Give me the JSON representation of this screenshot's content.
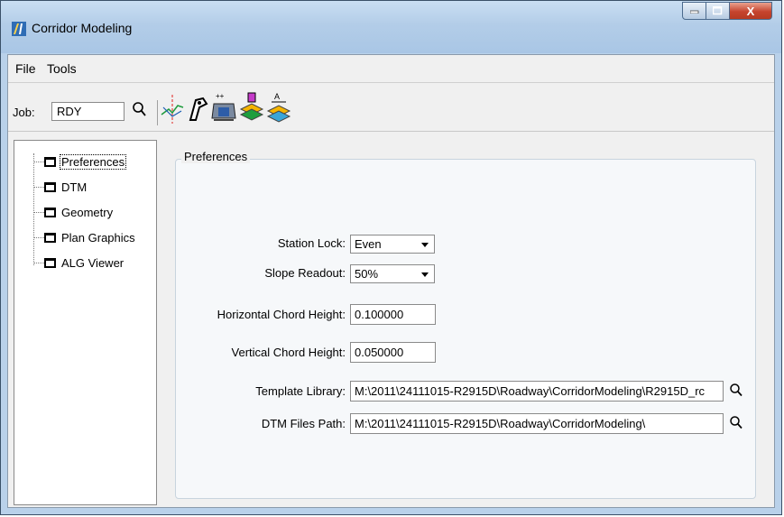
{
  "window": {
    "title": "Corridor Modeling",
    "controls": {
      "minimize": "–",
      "maximize": "□",
      "close": "X"
    }
  },
  "menu": {
    "file_label": "File",
    "tools_label": "Tools"
  },
  "toolbar": {
    "job_label": "Job:",
    "job_value": "RDY",
    "icons": [
      "search-icon",
      "alignment-icon",
      "template-tool-icon",
      "roadway-icon",
      "create-surface-icon",
      "design-stage-icon"
    ]
  },
  "tree": {
    "items": [
      {
        "label": "Preferences",
        "selected": true
      },
      {
        "label": "DTM",
        "selected": false
      },
      {
        "label": "Geometry",
        "selected": false
      },
      {
        "label": "Plan Graphics",
        "selected": false
      },
      {
        "label": "ALG Viewer",
        "selected": false
      }
    ]
  },
  "preferences": {
    "group_title": "Preferences",
    "station_lock": {
      "label": "Station Lock:",
      "value": "Even"
    },
    "slope_readout": {
      "label": "Slope Readout:",
      "value": "50%"
    },
    "horizontal_chord": {
      "label": "Horizontal Chord Height:",
      "value": "0.100000"
    },
    "vertical_chord": {
      "label": "Vertical Chord Height:",
      "value": "0.050000"
    },
    "template_library": {
      "label": "Template Library:",
      "value": "M:\\2011\\24111015-R2915D\\Roadway\\CorridorModeling\\R2915D_rc"
    },
    "dtm_files_path": {
      "label": "DTM Files Path:",
      "value": "M:\\2011\\24111015-R2915D\\Roadway\\CorridorModeling\\"
    }
  }
}
